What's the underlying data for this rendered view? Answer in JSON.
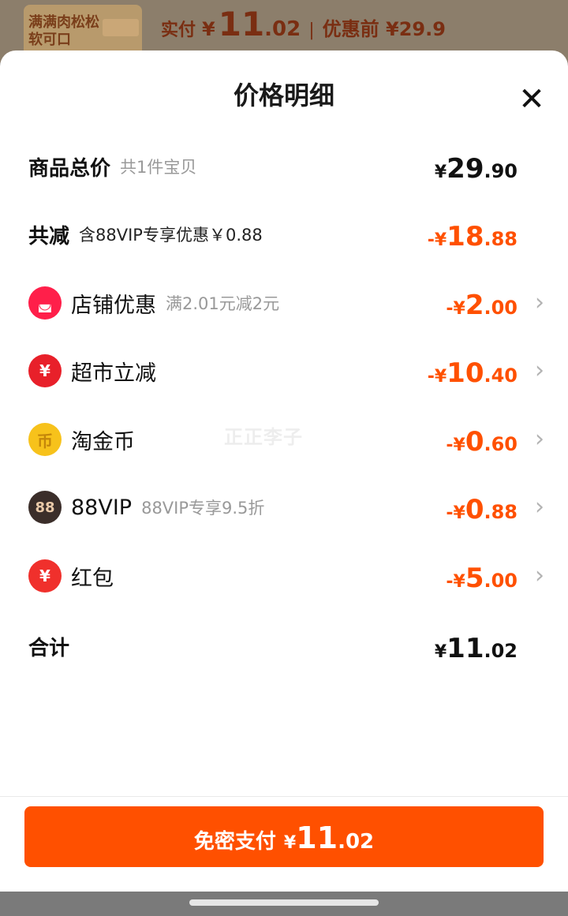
{
  "background": {
    "thumb_text": "满满肉松松软可口",
    "paid_label": "实付",
    "paid_yen": "¥",
    "paid_int": "11",
    "paid_dec": ".02",
    "separator": "|",
    "original_label": "优惠前 ¥29.9"
  },
  "sheet": {
    "title": "价格明细",
    "close_glyph": "✕"
  },
  "rows": [
    {
      "label": "商品总价",
      "sub": "共1件宝贝",
      "yen": "¥",
      "int": "29",
      "dec": ".90",
      "color": "black"
    },
    {
      "label": "共减",
      "sub": "含88VIP专享优惠￥0.88",
      "yen": "-¥",
      "int": "18",
      "dec": ".88",
      "color": "orange"
    },
    {
      "label": "店铺优惠",
      "sub": "满2.01元减2元",
      "yen": "-¥",
      "int": "2",
      "dec": ".00",
      "icon": "shop-icon",
      "icon_glyph": "◛",
      "icon_color": "#ff1f4a"
    },
    {
      "label": "超市立减",
      "sub": "",
      "yen": "-¥",
      "int": "10",
      "dec": ".40",
      "icon": "supermarket-discount-icon",
      "icon_glyph": "¥",
      "icon_color": "#e8202a"
    },
    {
      "label": "淘金币",
      "sub": "",
      "yen": "-¥",
      "int": "0",
      "dec": ".60",
      "icon": "gold-coin-icon",
      "icon_glyph": "币",
      "icon_color": "#f7c21b"
    },
    {
      "label": "88VIP",
      "sub": "88VIP专享9.5折",
      "yen": "-¥",
      "int": "0",
      "dec": ".88",
      "icon": "vip88-icon",
      "icon_glyph": "88",
      "icon_color": "#3b2e2a"
    },
    {
      "label": "红包",
      "sub": "",
      "yen": "-¥",
      "int": "5",
      "dec": ".00",
      "icon": "red-packet-icon",
      "icon_glyph": "¥",
      "icon_color": "#f0302c"
    }
  ],
  "total": {
    "label": "合计",
    "yen": "¥",
    "int": "11",
    "dec": ".02"
  },
  "watermark": "正正李子",
  "pay_button": {
    "label": "免密支付",
    "yen": "¥",
    "int": "11",
    "dec": ".02"
  },
  "chevron_glyph": "›",
  "colors": {
    "accent": "#ff5000",
    "muted": "#999999"
  }
}
